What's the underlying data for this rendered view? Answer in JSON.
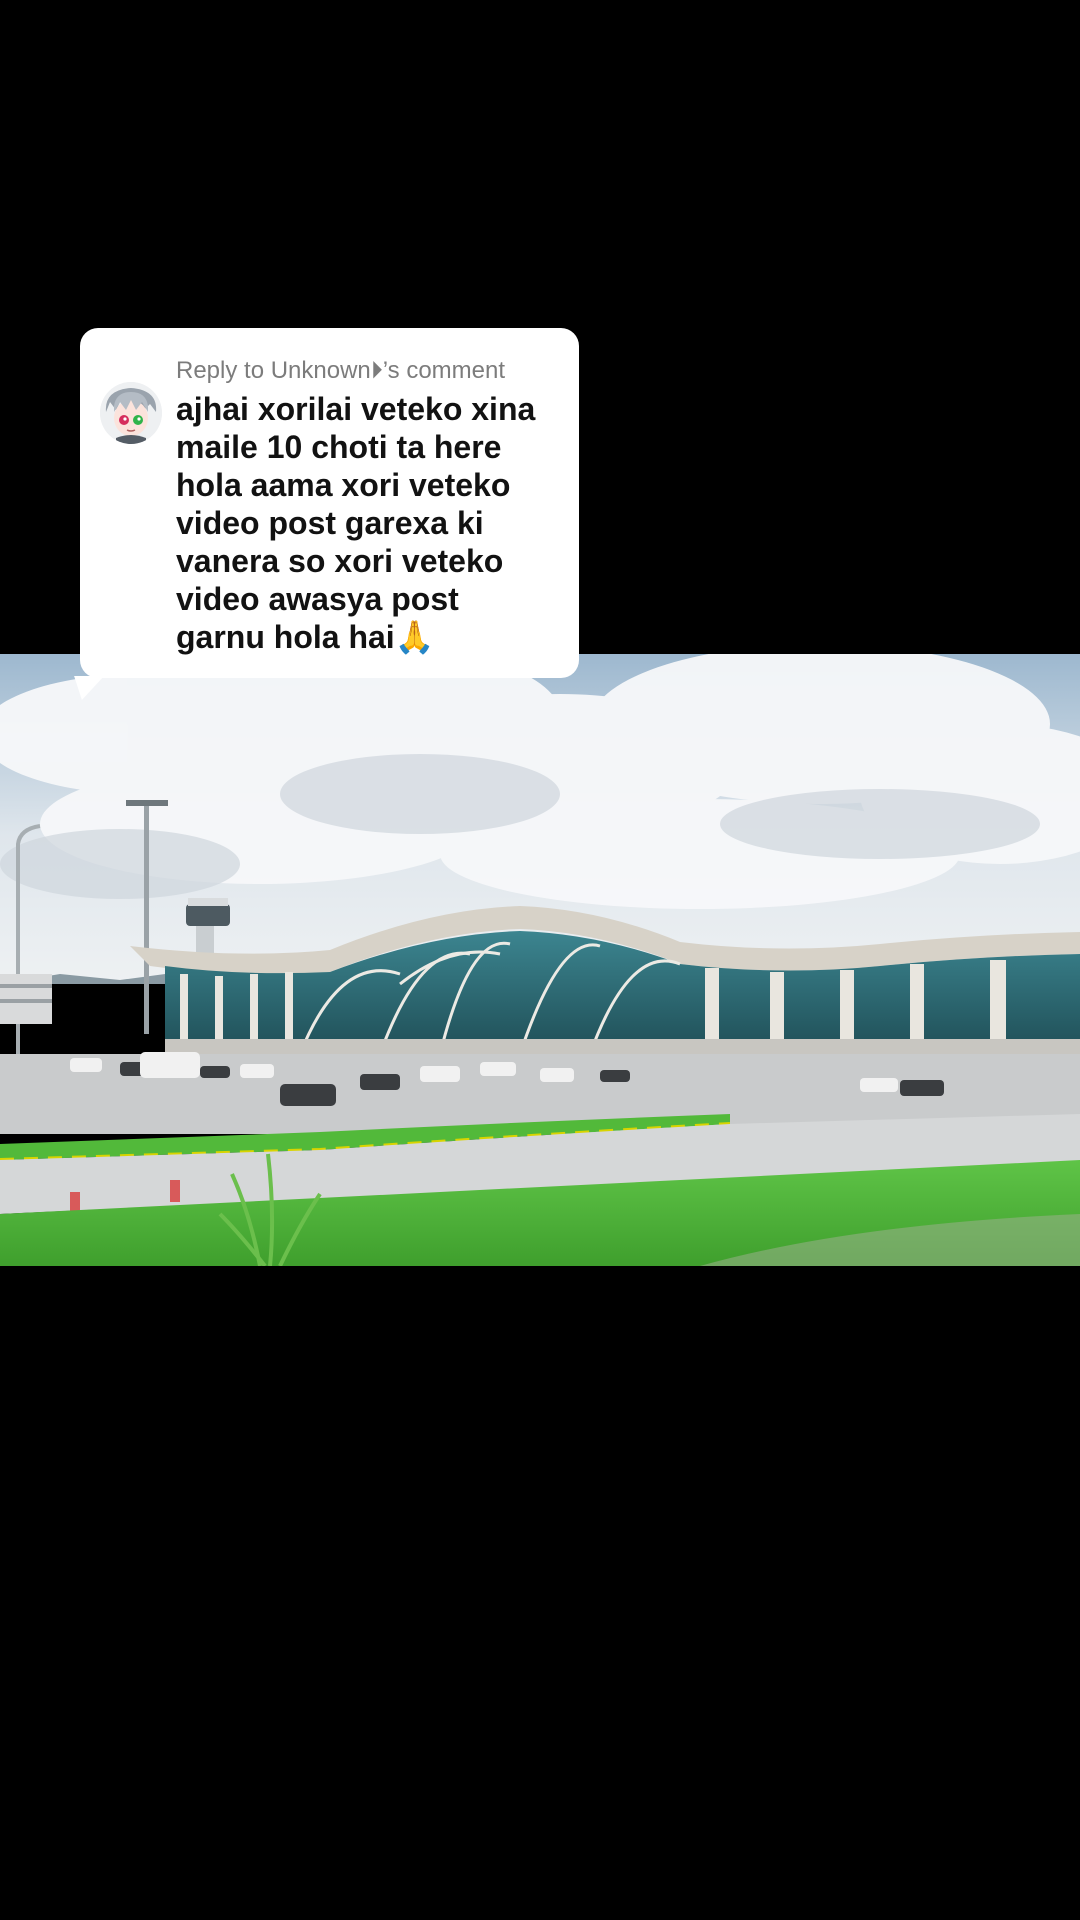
{
  "reply": {
    "header": "Reply to Unknown⏵’s comment",
    "text": "ajhai xorilai veteko xina maile 10 choti ta here hola aama xori veteko video post garexa ki vanera so xori veteko video awasya post garnu hola hai🙏"
  },
  "video": {
    "scene": "airport-terminal-photo"
  },
  "colors": {
    "background": "#000000",
    "card": "#ffffff",
    "header_text": "#7c7c7c",
    "body_text": "#121212",
    "grass": "#4fb83a",
    "terminal_glass": "#2f6d73"
  }
}
